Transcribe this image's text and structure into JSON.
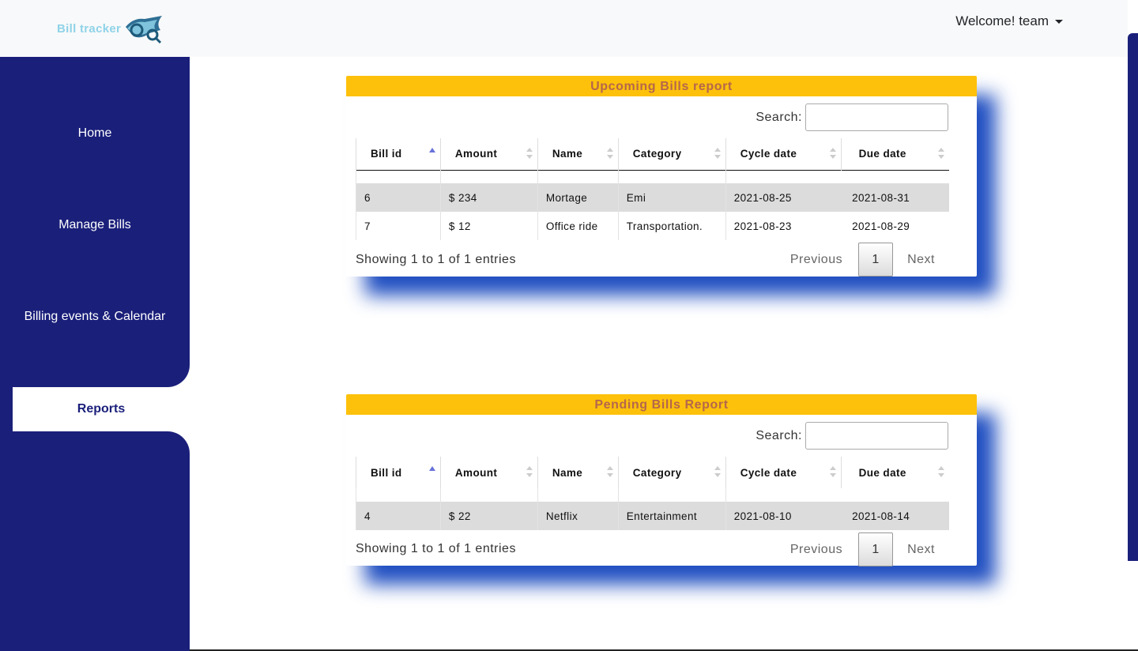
{
  "app": {
    "logo_text": "Bill tracker",
    "welcome": "Welcome! team",
    "brand_color": "#1a1f7a",
    "accent_color": "#fdc10b"
  },
  "sidebar": {
    "items": [
      {
        "label": "Home"
      },
      {
        "label": "Manage Bills"
      },
      {
        "label": "Billing events & Calendar"
      },
      {
        "label": "Reports",
        "active": true
      }
    ]
  },
  "upcoming": {
    "title": "Upcoming Bills report",
    "search_label": "Search:",
    "search_value": "",
    "columns": [
      "Bill id",
      "Amount",
      "Name",
      "Category",
      "Cycle date",
      "Due date"
    ],
    "rows": [
      [
        "6",
        "$ 234",
        "Mortage",
        "Emi",
        "2021-08-25",
        "2021-08-31"
      ],
      [
        "7",
        "$ 12",
        "Office ride",
        "Transportation.",
        "2021-08-23",
        "2021-08-29"
      ]
    ],
    "info": "Showing 1 to 1 of 1 entries",
    "prev_label": "Previous",
    "page": "1",
    "next_label": "Next"
  },
  "pending": {
    "title": "Pending Bills Report",
    "search_label": "Search:",
    "search_value": "",
    "columns": [
      "Bill id",
      "Amount",
      "Name",
      "Category",
      "Cycle date",
      "Due date"
    ],
    "rows": [
      [
        "4",
        "$ 22",
        "Netflix",
        "Entertainment",
        "2021-08-10",
        "2021-08-14"
      ]
    ],
    "info": "Showing 1 to 1 of 1 entries",
    "prev_label": "Previous",
    "page": "1",
    "next_label": "Next"
  }
}
